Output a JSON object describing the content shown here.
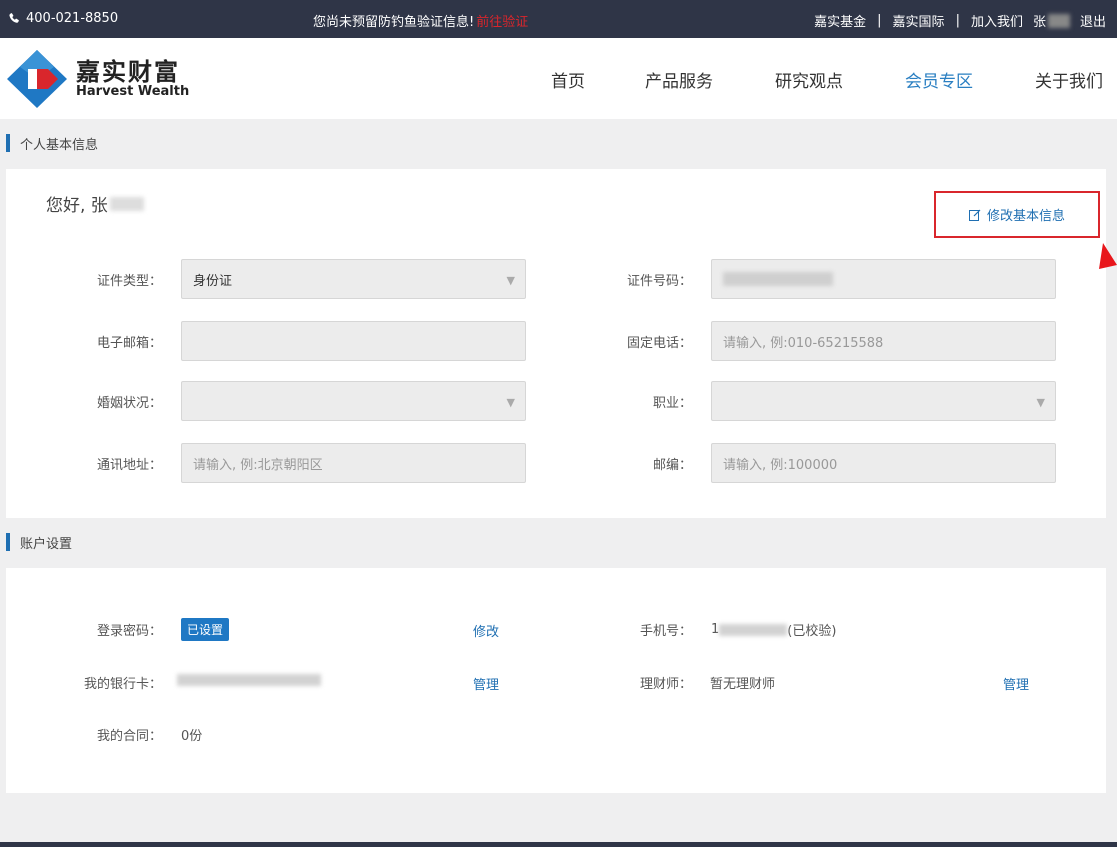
{
  "topbar": {
    "phone": "400-021-8850",
    "notice": "您尚未预留防钓鱼验证信息!",
    "verify_link": "前往验证",
    "links": [
      "嘉实基金",
      "嘉实国际",
      "加入我们"
    ],
    "separator": "|",
    "user_name": "张",
    "logout": "退出"
  },
  "logo": {
    "cn": "嘉实财富",
    "en": "Harvest Wealth"
  },
  "nav": [
    {
      "label": "首页"
    },
    {
      "label": "产品服务"
    },
    {
      "label": "研究观点"
    },
    {
      "label": "会员专区"
    },
    {
      "label": "关于我们"
    }
  ],
  "basic_info": {
    "section_title": "个人基本信息",
    "greeting": "您好, 张",
    "edit_button": "修改基本信息",
    "fields": {
      "id_type": {
        "label": "证件类型：",
        "value": "身份证"
      },
      "id_number": {
        "label": "证件号码："
      },
      "email": {
        "label": "电子邮箱："
      },
      "phone": {
        "label": "固定电话：",
        "placeholder": "请输入, 例:010-65215588"
      },
      "marital": {
        "label": "婚姻状况："
      },
      "job": {
        "label": "职业："
      },
      "address": {
        "label": "通讯地址：",
        "placeholder": "请输入, 例:北京朝阳区"
      },
      "zip": {
        "label": "邮编：",
        "placeholder": "请输入, 例:100000"
      }
    }
  },
  "account": {
    "section_title": "账户设置",
    "password_label": "登录密码：",
    "password_badge": "已设置",
    "password_action": "修改",
    "mobile_label": "手机号：",
    "mobile_prefix": "1",
    "mobile_status": "(已校验)",
    "bank_label": "我的银行卡：",
    "bank_action": "管理",
    "advisor_label": "理财师：",
    "advisor_value": "暂无理财师",
    "advisor_action": "管理",
    "contract_label": "我的合同：",
    "contract_value": "0份"
  },
  "colors": {
    "accent": "#1f6fb2",
    "alert": "#d9262c",
    "topbar": "#2f3547"
  },
  "icons": {
    "phone": "phone-icon",
    "edit": "edit-icon",
    "arrow": "red-arrow-icon"
  }
}
